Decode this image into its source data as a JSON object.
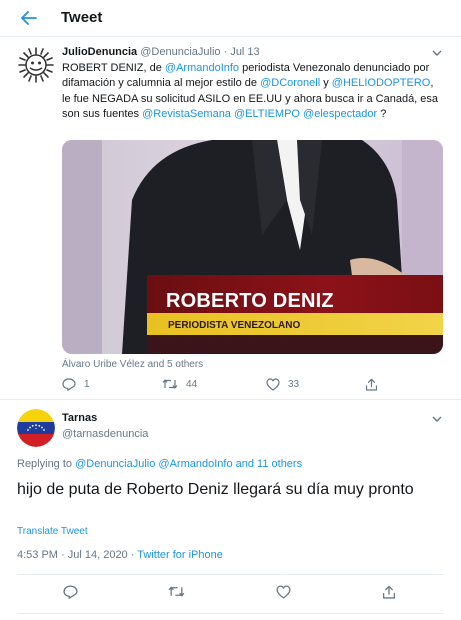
{
  "header": {
    "title": "Tweet",
    "back_icon": "arrow-left-icon"
  },
  "colors": {
    "link": "#1b95e0",
    "muted": "#657786",
    "text": "#14171a",
    "border": "#e6ecf0"
  },
  "parent_tweet": {
    "display_name": "JulioDenuncia",
    "handle": "@DenunciaJulio",
    "separator": "·",
    "date": "Jul 13",
    "text_segments": [
      {
        "t": "ROBERT DENIZ, de ",
        "link": false
      },
      {
        "t": "@ArmandoInfo",
        "link": true
      },
      {
        "t": " periodista Venezonalo denunciado por difamación y calumnia al mejor estilo de ",
        "link": false
      },
      {
        "t": "@DCoronell",
        "link": true
      },
      {
        "t": " y ",
        "link": false
      },
      {
        "t": "@HELIODOPTERO",
        "link": true
      },
      {
        "t": ",  le fue NEGADA su solicitud ASILO en EE.UU y ahora busca ir a Canadá, esa son sus fuentes ",
        "link": false
      },
      {
        "t": "@RevistaSemana",
        "link": true
      },
      {
        "t": " ",
        "link": false
      },
      {
        "t": "@ELTIEMPO",
        "link": true
      },
      {
        "t": " ",
        "link": false
      },
      {
        "t": "@elespectador",
        "link": true
      },
      {
        "t": " ?",
        "link": false
      }
    ],
    "media": {
      "lower_third_name": "ROBERTO DENIZ",
      "lower_third_subtitle": "PERIODISTA VENEZOLANO"
    },
    "media_caption": "Álvaro Uribe Vélez and 5 others",
    "actions": {
      "reply_count": "1",
      "retweet_count": "44",
      "like_count": "33"
    }
  },
  "main_tweet": {
    "display_name": "Tarnas",
    "handle": "@tarnasdenuncia",
    "replying_prefix": "Replying to ",
    "replying_to_1": "@DenunciaJulio",
    "replying_to_2": "@ArmandoInfo",
    "replying_and": " and 11 others",
    "text": "hijo de puta de Roberto Deniz llegará su día muy pronto",
    "translate_label": "Translate Tweet",
    "time": "4:53 PM · Jul 14, 2020",
    "meta_separator": " · ",
    "source": "Twitter for iPhone"
  }
}
